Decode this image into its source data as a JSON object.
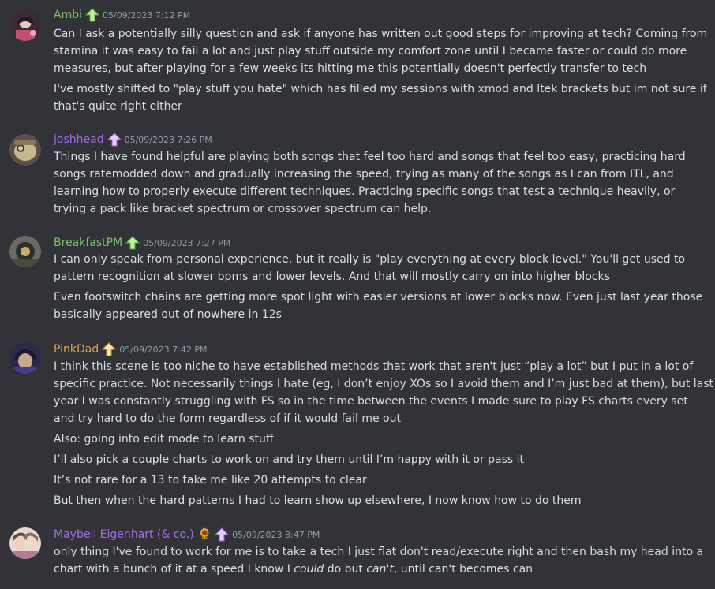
{
  "messages": [
    {
      "author": "Ambi",
      "author_color": "#7fbf6a",
      "timestamp": "05/09/2023 7:12 PM",
      "paragraphs": [
        [
          "Can I ask a potentially silly question and ask if anyone has written out good steps for improving at tech? Coming from",
          "stamina it was easy to fail a lot and just play stuff outside my comfort zone until I became faster or could do more",
          "measures, but after playing for a few weeks its hitting me this potentially doesn't perfectly transfer to tech"
        ],
        [
          "I've mostly shifted to \"play stuff you hate\" which has filled my sessions with xmod and ltek brackets but im not sure if",
          "that's quite right either"
        ]
      ]
    },
    {
      "author": "joshhead",
      "author_color": "#a36de3",
      "timestamp": "05/09/2023 7:26 PM",
      "paragraphs": [
        [
          "Things I have found helpful are playing both songs that feel too hard and songs that feel too easy, practicing hard",
          "songs ratemodded down and gradually increasing the speed,   trying as many of the songs as I can from ITL, and",
          "learning how to properly execute different techniques. Practicing specific songs that test a technique heavily, or",
          "trying a pack like bracket spectrum or crossover spectrum can help."
        ]
      ]
    },
    {
      "author": "BreakfastPM",
      "author_color": "#7fbf6a",
      "timestamp": "05/09/2023 7:27 PM",
      "paragraphs": [
        [
          "I can only speak from personal experience, but it really is \"play everything at every block level.\" You'll get used to",
          "pattern recognition at slower bpms and lower levels. And that will mostly carry on into higher blocks"
        ],
        [
          "Even footswitch chains are getting more spot light with easier versions at lower blocks now. Even just last year those",
          "basically appeared out of nowhere in 12s"
        ]
      ]
    },
    {
      "author": "PinkDad",
      "author_color": "#d6a94a",
      "timestamp": "05/09/2023 7:42 PM",
      "paragraphs": [
        [
          "I think this scene is too niche to have established methods that work that aren't just “play a lot” but I put in a lot of",
          "specific practice. Not necessarily things I hate (eg, I don’t enjoy XOs so I avoid them and I’m just bad at them), but last",
          "year I was constantly struggling with FS so in the time between the events I made sure to play FS charts every set",
          "and try hard to do the form regardless of if it would fail me out"
        ],
        [
          "Also: going into edit mode to learn stuff"
        ],
        [
          "I’ll also pick a couple charts to work on and try them until I’m happy with it or pass it"
        ],
        [
          "It’s not rare for a 13 to take me like 20 attempts to clear"
        ],
        [
          "But then when the hard patterns I had to learn show up elsewhere, I now know how to do them"
        ]
      ]
    },
    {
      "author": "Maybell Eigenhart (& co.)",
      "author_color": "#a36de3",
      "timestamp": "05/09/2023 8:47 PM",
      "badge": "🌻",
      "paragraphs": [
        [
          "only thing I've found to work for me is to take a tech I just flat don't read/execute right and then bash my head into a"
        ]
      ],
      "last_line": {
        "a": "chart with a bunch of it at a speed I know I ",
        "b": "could",
        "c": " do but ",
        "d": "can't",
        "e": ", until can't becomes can"
      }
    }
  ],
  "icons": {
    "role": "arrow-up-icon",
    "badge": "sunflower-icon"
  }
}
